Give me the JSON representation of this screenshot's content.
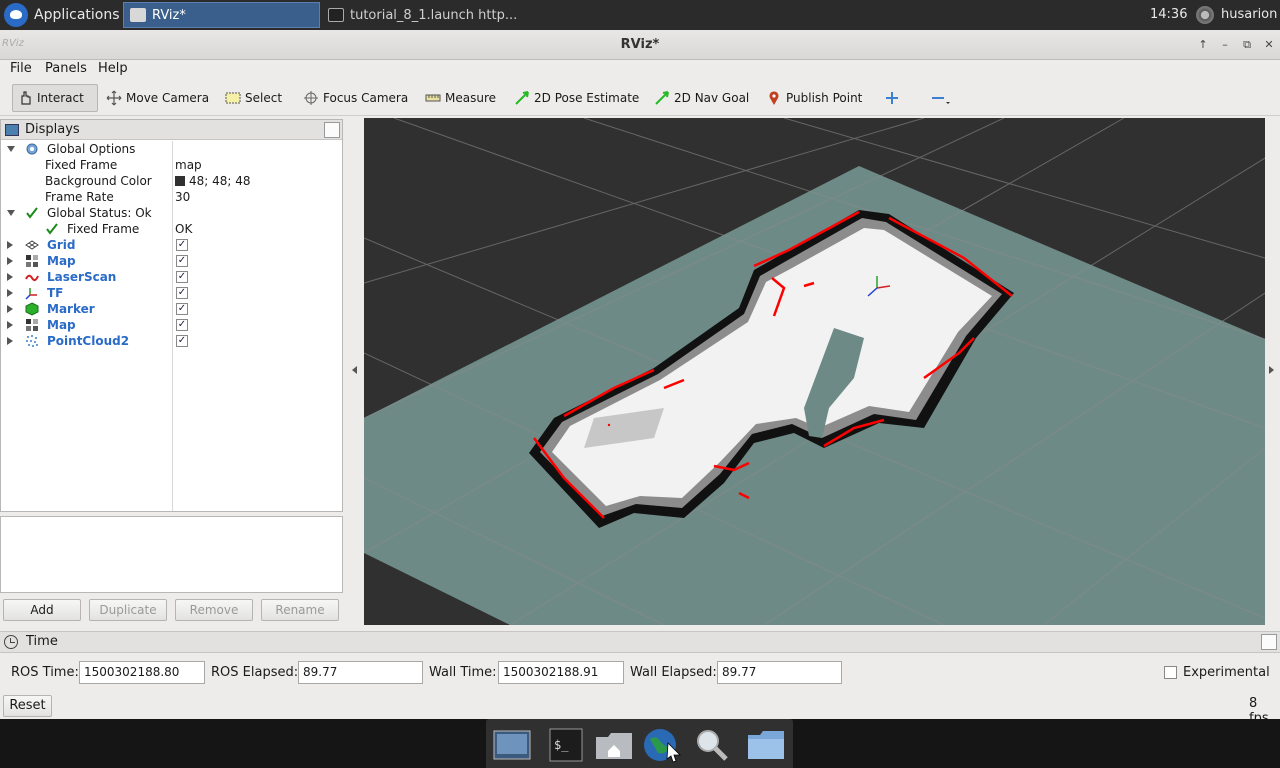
{
  "top_panel": {
    "applications_label": "Applications",
    "tasks": [
      {
        "label": "RViz*"
      },
      {
        "label": "tutorial_8_1.launch http..."
      }
    ],
    "clock": "14:36",
    "user": "husarion"
  },
  "window": {
    "title": "RViz*",
    "logo_text": "RViz"
  },
  "menu": {
    "items": [
      "File",
      "Panels",
      "Help"
    ]
  },
  "toolbar": {
    "tools": [
      "Interact",
      "Move Camera",
      "Select",
      "Focus Camera",
      "Measure",
      "2D Pose Estimate",
      "2D Nav Goal",
      "Publish Point"
    ]
  },
  "displays": {
    "title": "Displays",
    "global_options": {
      "label": "Global Options",
      "fixed_frame_label": "Fixed Frame",
      "fixed_frame_value": "map",
      "background_color_label": "Background Color",
      "background_color_value": "48; 48; 48",
      "background_color_hex": "#303030",
      "frame_rate_label": "Frame Rate",
      "frame_rate_value": "30"
    },
    "global_status": {
      "label": "Global Status: Ok",
      "fixed_frame_label": "Fixed Frame",
      "fixed_frame_value": "OK"
    },
    "items": [
      {
        "label": "Grid",
        "icon": "grid-icon",
        "checked": true
      },
      {
        "label": "Map",
        "icon": "map-icon",
        "checked": true
      },
      {
        "label": "LaserScan",
        "icon": "laserscan-icon",
        "checked": true
      },
      {
        "label": "TF",
        "icon": "tf-icon",
        "checked": true
      },
      {
        "label": "Marker",
        "icon": "marker-icon",
        "checked": true
      },
      {
        "label": "Map",
        "icon": "map-icon",
        "checked": true
      },
      {
        "label": "PointCloud2",
        "icon": "pointcloud-icon",
        "checked": true
      }
    ],
    "buttons": {
      "add": "Add",
      "duplicate": "Duplicate",
      "remove": "Remove",
      "rename": "Rename"
    }
  },
  "time": {
    "title": "Time",
    "ros_time_label": "ROS Time:",
    "ros_time_value": "1500302188.80",
    "ros_elapsed_label": "ROS Elapsed:",
    "ros_elapsed_value": "89.77",
    "wall_time_label": "Wall Time:",
    "wall_time_value": "1500302188.91",
    "wall_elapsed_label": "Wall Elapsed:",
    "wall_elapsed_value": "89.77",
    "experimental_label": "Experimental",
    "reset_label": "Reset",
    "fps": "8 fps"
  },
  "colors": {
    "accent": "#2a6bc8",
    "view_background": "#303030",
    "map_unknown": "#6e8a87",
    "laser": "#ff0000"
  }
}
